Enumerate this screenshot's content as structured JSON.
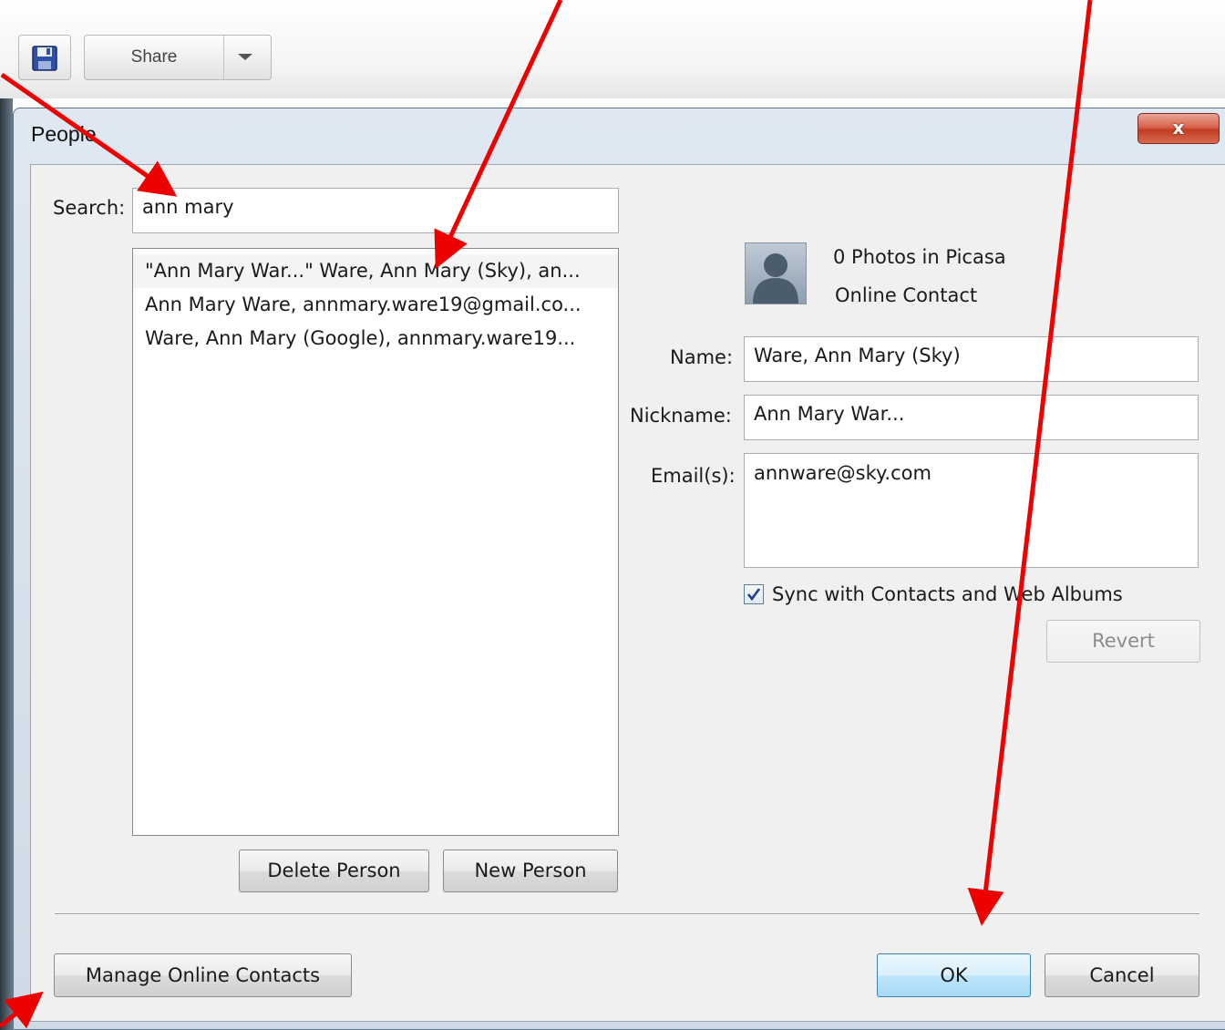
{
  "toolbar": {
    "share_label": "Share"
  },
  "dialog": {
    "title": "People",
    "close_glyph": "x"
  },
  "search": {
    "label": "Search:",
    "value": "ann mary"
  },
  "results": [
    "\"Ann Mary War...\" Ware, Ann Mary (Sky), an...",
    "Ann Mary Ware, annmary.ware19@gmail.co...",
    "Ware, Ann Mary (Google), annmary.ware19..."
  ],
  "buttons": {
    "delete_person": "Delete Person",
    "new_person": "New Person",
    "manage_online_contacts": "Manage Online Contacts",
    "ok": "OK",
    "cancel": "Cancel",
    "revert": "Revert"
  },
  "details": {
    "photos_count": "0 Photos in Picasa",
    "contact_type": "Online Contact",
    "name_label": "Name:",
    "name_value": "Ware, Ann Mary (Sky)",
    "nickname_label": "Nickname:",
    "nickname_value": "Ann Mary War...",
    "emails_label": "Email(s):",
    "emails_value": "annware@sky.com",
    "sync_label": "Sync with Contacts and Web Albums",
    "sync_checked": true
  },
  "icons": {
    "save": "floppy-disk-icon",
    "avatar": "person-silhouette-icon",
    "check": "checkmark-icon"
  },
  "colors": {
    "annotation_arrow": "#ee0000",
    "close_button": "#c94a33",
    "default_button_border": "#3c7fb1"
  }
}
